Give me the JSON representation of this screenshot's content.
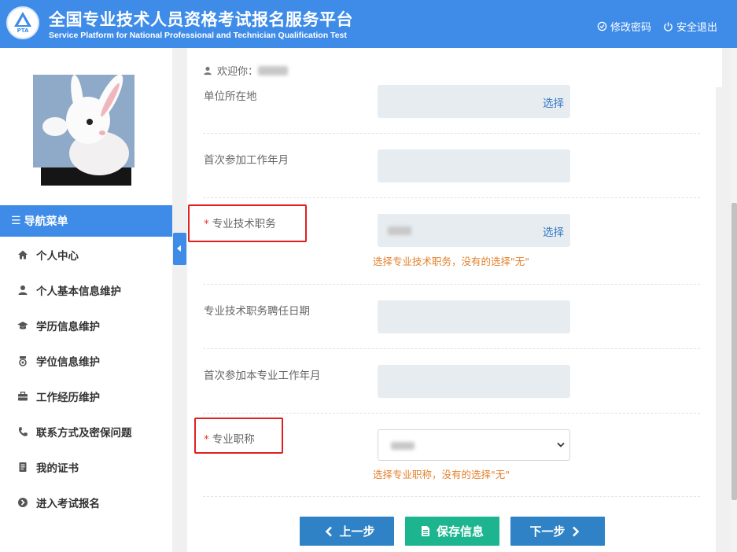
{
  "header": {
    "logo_text": "PTA",
    "title": "全国专业技术人员资格考试报名服务平台",
    "subtitle": "Service Platform for National Professional and Technician Qualification Test",
    "change_password": "修改密码",
    "logout": "安全退出"
  },
  "sidebar": {
    "nav_title": "导航菜单",
    "items": [
      {
        "label": "个人中心",
        "icon": "home-icon"
      },
      {
        "label": "个人基本信息维护",
        "icon": "user-icon"
      },
      {
        "label": "学历信息维护",
        "icon": "graduation-cap-icon"
      },
      {
        "label": "学位信息维护",
        "icon": "medal-icon"
      },
      {
        "label": "工作经历维护",
        "icon": "briefcase-icon"
      },
      {
        "label": "联系方式及密保问题",
        "icon": "phone-icon"
      },
      {
        "label": "我的证书",
        "icon": "certificate-icon"
      },
      {
        "label": "进入考试报名",
        "icon": "arrow-circle-right-icon"
      }
    ]
  },
  "main": {
    "welcome_label": "欢迎你：",
    "fields": [
      {
        "label": "单位所在地",
        "required": false,
        "value": "",
        "action": "选择"
      },
      {
        "label": "首次参加工作年月",
        "required": false,
        "value": ""
      },
      {
        "label": "专业技术职务",
        "required": true,
        "value": "",
        "action": "选择",
        "hint": "选择专业技术职务，没有的选择\"无\""
      },
      {
        "label": "专业技术职务聘任日期",
        "required": false,
        "value": ""
      },
      {
        "label": "首次参加本专业工作年月",
        "required": false,
        "value": ""
      },
      {
        "label": "专业职称",
        "required": true,
        "value": "",
        "hint": "选择专业职称，没有的选择\"无\""
      }
    ],
    "required_mark": "*",
    "buttons": {
      "prev": "上一步",
      "save": "保存信息",
      "next": "下一步"
    }
  },
  "colors": {
    "primary": "#3e8ce8",
    "button_blue": "#2f82c6",
    "button_green": "#1db58f",
    "hint_orange": "#e3812e",
    "link_blue": "#3478c6",
    "highlight_red": "#e02020"
  }
}
